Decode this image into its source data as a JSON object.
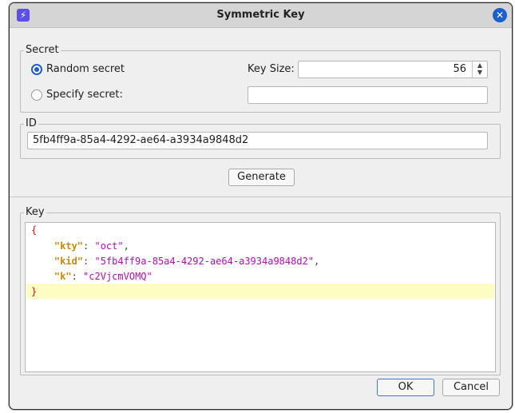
{
  "window": {
    "title": "Symmetric Key"
  },
  "secret": {
    "legend": "Secret",
    "random_label": "Random secret",
    "specify_label": "Specify secret:",
    "key_size_label": "Key Size:",
    "key_size_value": "56",
    "specify_value": ""
  },
  "id": {
    "legend": "ID",
    "value": "5fb4ff9a-85a4-4292-ae64-a3934a9848d2"
  },
  "generate_label": "Generate",
  "key": {
    "legend": "Key",
    "open_brace": "{",
    "close_brace": "}",
    "entries": [
      {
        "name": "\"kty\"",
        "value": "\"oct\"",
        "trail": ","
      },
      {
        "name": "\"kid\"",
        "value": "\"5fb4ff9a-85a4-4292-ae64-a3934a9848d2\"",
        "trail": ","
      },
      {
        "name": "\"k\"",
        "value": "\"c2VjcmVOMQ\"",
        "trail": ""
      }
    ]
  },
  "buttons": {
    "ok": "OK",
    "cancel": "Cancel"
  },
  "colors": {
    "accent": "#1c5fcb",
    "highlight_line": "#fdfcc2"
  }
}
